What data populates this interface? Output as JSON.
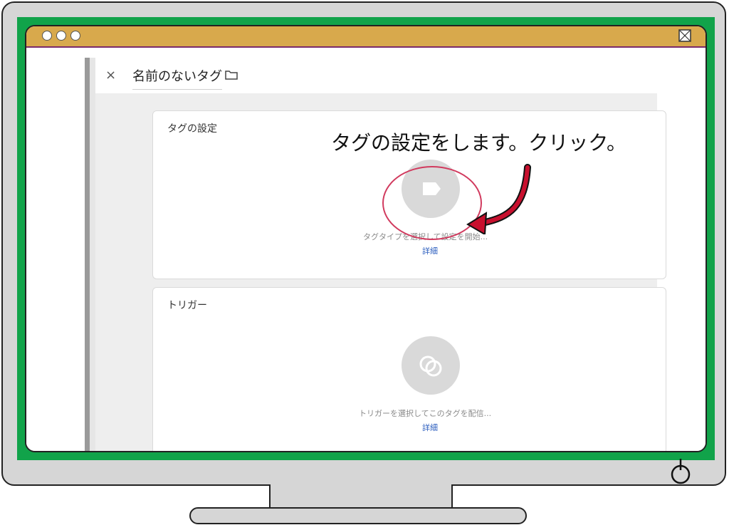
{
  "editor": {
    "close_glyph": "×",
    "tag_name": "名前のないタグ"
  },
  "tag_config": {
    "title": "タグの設定",
    "description": "タグタイプを選択して設定を開始...",
    "link": "詳細"
  },
  "trigger": {
    "title": "トリガー",
    "description": "トリガーを選択してこのタグを配信...",
    "link": "詳細"
  },
  "annotation": {
    "text": "タグの設定をします。クリック。"
  },
  "icons": {
    "folder": "folder-icon",
    "tag": "tag-icon",
    "trigger": "trigger-icon",
    "power": "power-icon",
    "window_close": "window-close-icon"
  },
  "colors": {
    "screen_border": "#11a34a",
    "titlebar": "#d8a94c",
    "highlight": "#d13a5e",
    "arrow": "#c8102e",
    "link": "#2d5fbf"
  }
}
